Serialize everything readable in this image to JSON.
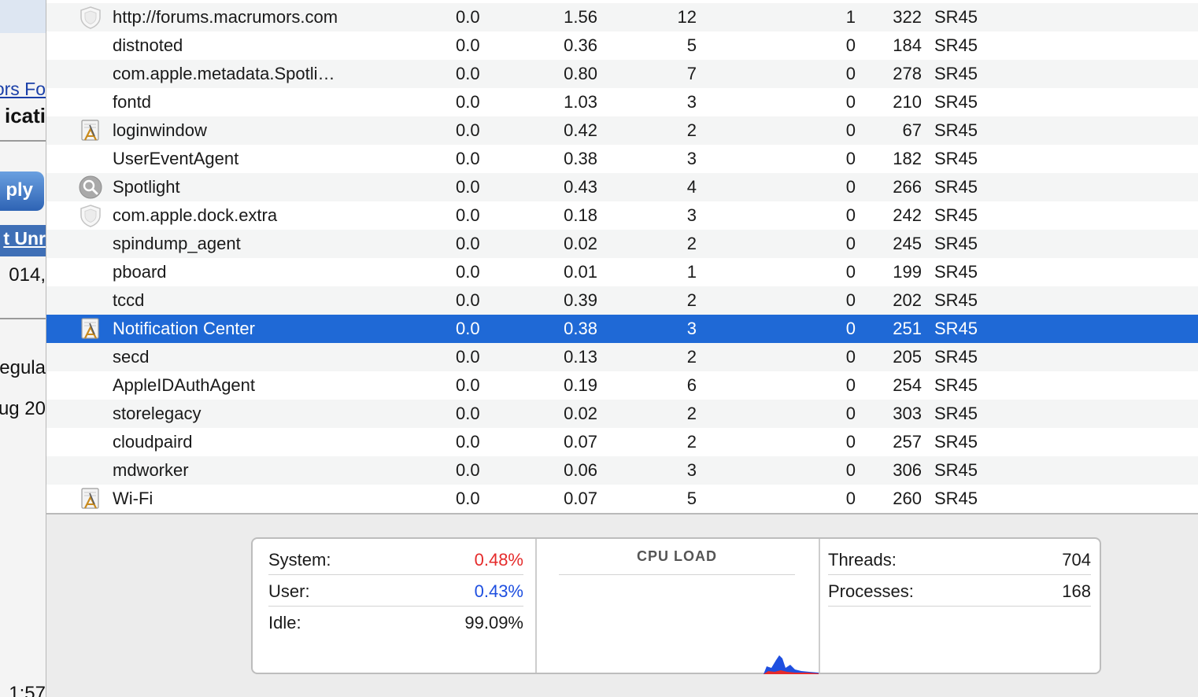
{
  "background_window": {
    "frag_1": "ors Fo",
    "frag_2": "icati",
    "frag_3": "ply",
    "frag_4": "t Unr",
    "frag_5": "014,",
    "frag_6": "egula",
    "frag_7": "ug 20",
    "frag_8": "1:57"
  },
  "colors": {
    "selection": "#1f69d6",
    "system": "#e52b2b",
    "user": "#1e4fe0"
  },
  "processes": [
    {
      "icon": "generic-app-shield-icon",
      "name": "http://forums.macrumors.com",
      "cpu": "0.0",
      "cpu_time": "1.56",
      "threads": "12",
      "ports": "1",
      "pid": "322",
      "user": "SR45"
    },
    {
      "icon": "",
      "name": "distnoted",
      "cpu": "0.0",
      "cpu_time": "0.36",
      "threads": "5",
      "ports": "0",
      "pid": "184",
      "user": "SR45"
    },
    {
      "icon": "",
      "name": "com.apple.metadata.Spotli…",
      "cpu": "0.0",
      "cpu_time": "0.80",
      "threads": "7",
      "ports": "0",
      "pid": "278",
      "user": "SR45"
    },
    {
      "icon": "",
      "name": "fontd",
      "cpu": "0.0",
      "cpu_time": "1.03",
      "threads": "3",
      "ports": "0",
      "pid": "210",
      "user": "SR45"
    },
    {
      "icon": "app-pencil-icon",
      "name": "loginwindow",
      "cpu": "0.0",
      "cpu_time": "0.42",
      "threads": "2",
      "ports": "0",
      "pid": "67",
      "user": "SR45"
    },
    {
      "icon": "",
      "name": "UserEventAgent",
      "cpu": "0.0",
      "cpu_time": "0.38",
      "threads": "3",
      "ports": "0",
      "pid": "182",
      "user": "SR45"
    },
    {
      "icon": "spotlight-icon",
      "name": "Spotlight",
      "cpu": "0.0",
      "cpu_time": "0.43",
      "threads": "4",
      "ports": "0",
      "pid": "266",
      "user": "SR45"
    },
    {
      "icon": "generic-app-shield-icon",
      "name": "com.apple.dock.extra",
      "cpu": "0.0",
      "cpu_time": "0.18",
      "threads": "3",
      "ports": "0",
      "pid": "242",
      "user": "SR45"
    },
    {
      "icon": "",
      "name": "spindump_agent",
      "cpu": "0.0",
      "cpu_time": "0.02",
      "threads": "2",
      "ports": "0",
      "pid": "245",
      "user": "SR45"
    },
    {
      "icon": "",
      "name": "pboard",
      "cpu": "0.0",
      "cpu_time": "0.01",
      "threads": "1",
      "ports": "0",
      "pid": "199",
      "user": "SR45"
    },
    {
      "icon": "",
      "name": "tccd",
      "cpu": "0.0",
      "cpu_time": "0.39",
      "threads": "2",
      "ports": "0",
      "pid": "202",
      "user": "SR45"
    },
    {
      "icon": "app-pencil-icon",
      "name": "Notification Center",
      "cpu": "0.0",
      "cpu_time": "0.38",
      "threads": "3",
      "ports": "0",
      "pid": "251",
      "user": "SR45",
      "selected": true
    },
    {
      "icon": "",
      "name": "secd",
      "cpu": "0.0",
      "cpu_time": "0.13",
      "threads": "2",
      "ports": "0",
      "pid": "205",
      "user": "SR45"
    },
    {
      "icon": "",
      "name": "AppleIDAuthAgent",
      "cpu": "0.0",
      "cpu_time": "0.19",
      "threads": "6",
      "ports": "0",
      "pid": "254",
      "user": "SR45"
    },
    {
      "icon": "",
      "name": "storelegacy",
      "cpu": "0.0",
      "cpu_time": "0.02",
      "threads": "2",
      "ports": "0",
      "pid": "303",
      "user": "SR45"
    },
    {
      "icon": "",
      "name": "cloudpaird",
      "cpu": "0.0",
      "cpu_time": "0.07",
      "threads": "2",
      "ports": "0",
      "pid": "257",
      "user": "SR45"
    },
    {
      "icon": "",
      "name": "mdworker",
      "cpu": "0.0",
      "cpu_time": "0.06",
      "threads": "3",
      "ports": "0",
      "pid": "306",
      "user": "SR45"
    },
    {
      "icon": "app-pencil-icon",
      "name": "Wi-Fi",
      "cpu": "0.0",
      "cpu_time": "0.07",
      "threads": "5",
      "ports": "0",
      "pid": "260",
      "user": "SR45"
    }
  ],
  "stats": {
    "system": {
      "label": "System:",
      "value": "0.48%"
    },
    "user": {
      "label": "User:",
      "value": "0.43%"
    },
    "idle": {
      "label": "Idle:",
      "value": "99.09%"
    },
    "cpu_load_title": "CPU LOAD",
    "threads": {
      "label": "Threads:",
      "value": "704"
    },
    "processes": {
      "label": "Processes:",
      "value": "168"
    }
  }
}
